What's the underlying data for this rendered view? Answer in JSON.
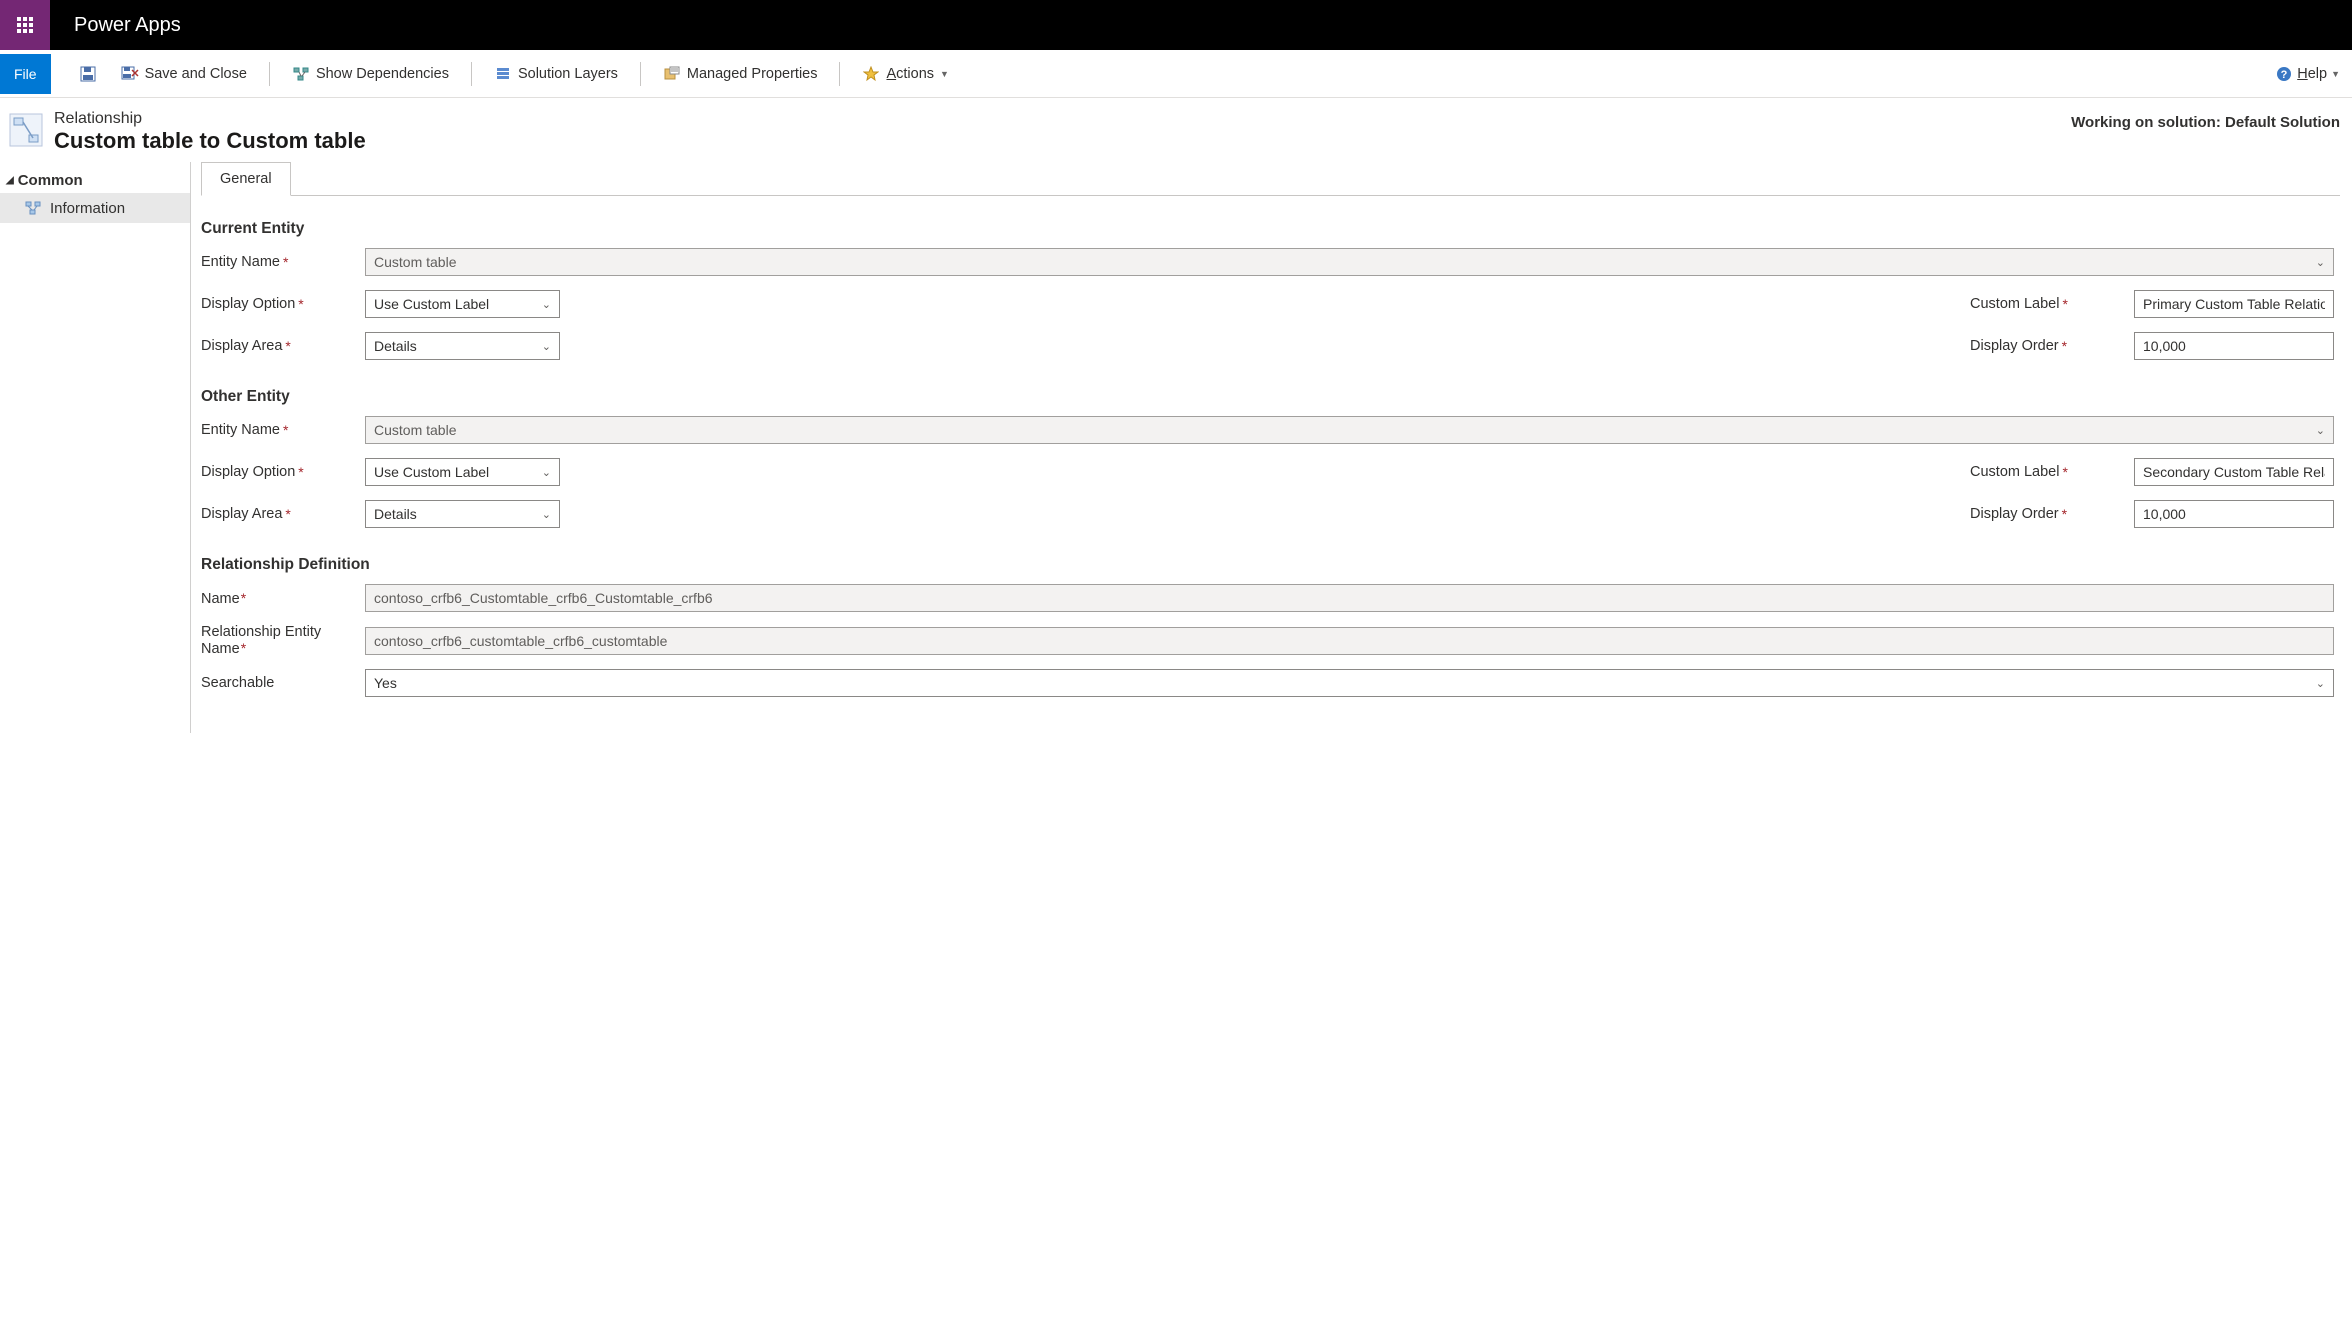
{
  "header": {
    "app_name": "Power Apps"
  },
  "commandbar": {
    "file": "File",
    "save_and_close": "Save and Close",
    "show_dependencies": "Show Dependencies",
    "solution_layers": "Solution Layers",
    "managed_properties": "Managed Properties",
    "actions": "Actions",
    "help": "Help"
  },
  "page_header": {
    "subtitle": "Relationship",
    "title": "Custom table to Custom table",
    "solution_context": "Working on solution: Default Solution"
  },
  "sidebar": {
    "group": "Common",
    "items": [
      {
        "label": "Information"
      }
    ]
  },
  "tabs": {
    "general": "General"
  },
  "sections": {
    "current_entity": "Current Entity",
    "other_entity": "Other Entity",
    "relationship_definition": "Relationship Definition"
  },
  "labels": {
    "entity_name": "Entity Name",
    "display_option": "Display Option",
    "custom_label": "Custom Label",
    "display_area": "Display Area",
    "display_order": "Display Order",
    "name": "Name",
    "relationship_entity_name": "Relationship Entity Name",
    "searchable": "Searchable"
  },
  "form": {
    "current": {
      "entity_name": "Custom table",
      "display_option": "Use Custom Label",
      "custom_label": "Primary Custom Table Relationship",
      "display_area": "Details",
      "display_order": "10,000"
    },
    "other": {
      "entity_name": "Custom table",
      "display_option": "Use Custom Label",
      "custom_label": "Secondary Custom Table Relationship",
      "display_area": "Details",
      "display_order": "10,000"
    },
    "definition": {
      "name": "contoso_crfb6_Customtable_crfb6_Customtable_crfb6",
      "relationship_entity_name": "contoso_crfb6_customtable_crfb6_customtable",
      "searchable": "Yes"
    }
  }
}
